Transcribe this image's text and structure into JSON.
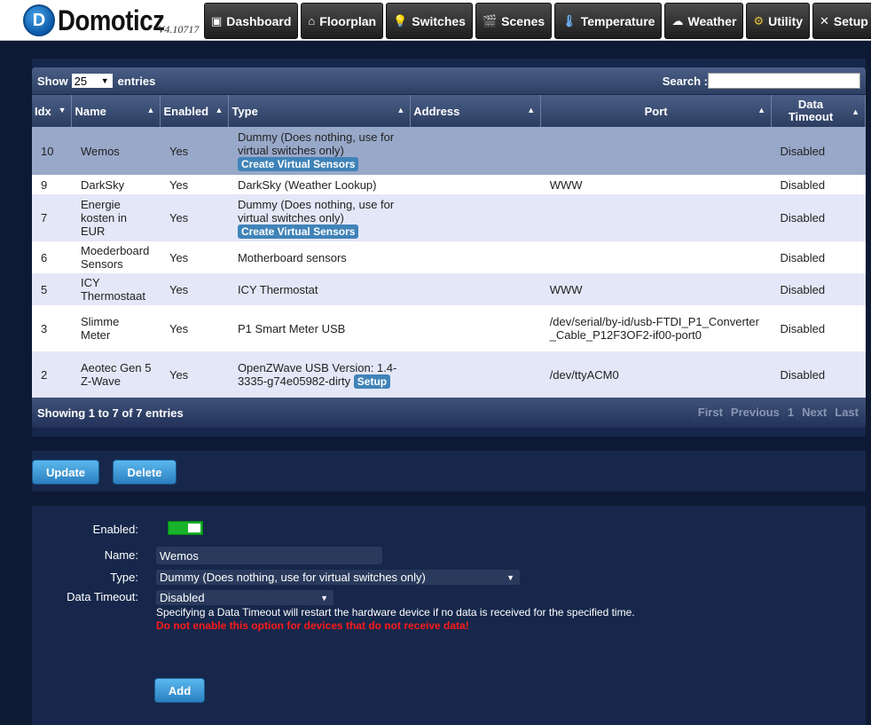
{
  "app": {
    "logo_letter": "D",
    "name": "Domoticz",
    "version": "V4.10717"
  },
  "nav": [
    {
      "label": "Dashboard",
      "icon": "dashboard-icon",
      "glyph": "▣"
    },
    {
      "label": "Floorplan",
      "icon": "floorplan-icon",
      "glyph": "⌂"
    },
    {
      "label": "Switches",
      "icon": "lightbulb-icon",
      "glyph": "💡"
    },
    {
      "label": "Scenes",
      "icon": "clapperboard-icon",
      "glyph": "🎬"
    },
    {
      "label": "Temperature",
      "icon": "thermometer-icon",
      "glyph": "🌡"
    },
    {
      "label": "Weather",
      "icon": "cloud-icon",
      "glyph": "☁"
    },
    {
      "label": "Utility",
      "icon": "utility-icon",
      "glyph": "⚙"
    },
    {
      "label": "Setup",
      "icon": "tools-icon",
      "glyph": "✕"
    }
  ],
  "table": {
    "show_label": "Show",
    "show_value": "25",
    "entries_label": "entries",
    "search_label": "Search :",
    "columns": [
      "Idx",
      "Name",
      "Enabled",
      "Type",
      "Address",
      "Port",
      "Data Timeout"
    ],
    "rows": [
      {
        "idx": "10",
        "name": "Wemos",
        "enabled": "Yes",
        "type": "Dummy (Does nothing, use for virtual switches only)",
        "button": "Create Virtual Sensors",
        "address": "",
        "port": "",
        "timeout": "Disabled"
      },
      {
        "idx": "9",
        "name": "DarkSky",
        "enabled": "Yes",
        "type": "DarkSky (Weather Lookup)",
        "button": "",
        "address": "",
        "port": "WWW",
        "timeout": "Disabled"
      },
      {
        "idx": "7",
        "name": "Energie kosten in EUR",
        "enabled": "Yes",
        "type": "Dummy (Does nothing, use for virtual switches only)",
        "button": "Create Virtual Sensors",
        "address": "",
        "port": "",
        "timeout": "Disabled"
      },
      {
        "idx": "6",
        "name": "Moederboard Sensors",
        "enabled": "Yes",
        "type": "Motherboard sensors",
        "button": "",
        "address": "",
        "port": "",
        "timeout": "Disabled"
      },
      {
        "idx": "5",
        "name": "ICY Thermostaat",
        "enabled": "Yes",
        "type": "ICY Thermostat",
        "button": "",
        "address": "",
        "port": "WWW",
        "timeout": "Disabled"
      },
      {
        "idx": "3",
        "name": "Slimme Meter",
        "enabled": "Yes",
        "type": "P1 Smart Meter USB",
        "button": "",
        "address": "",
        "port": "/dev/serial/by-id/usb-FTDI_P1_Converter_Cable_P12F3OF2-if00-port0",
        "timeout": "Disabled"
      },
      {
        "idx": "2",
        "name": "Aeotec Gen 5 Z-Wave",
        "enabled": "Yes",
        "type": "OpenZWave USB Version: 1.4-3335-g74e05982-dirty",
        "button": "Setup",
        "address": "",
        "port": "/dev/ttyACM0",
        "timeout": "Disabled"
      }
    ],
    "info": "Showing 1 to 7 of 7 entries",
    "pager": [
      "First",
      "Previous",
      "1",
      "Next",
      "Last"
    ]
  },
  "actions": {
    "update": "Update",
    "delete": "Delete"
  },
  "form": {
    "enabled_label": "Enabled:",
    "name_label": "Name:",
    "name_value": "Wemos",
    "type_label": "Type:",
    "type_value": "Dummy (Does nothing, use for virtual switches only)",
    "timeout_label": "Data Timeout:",
    "timeout_value": "Disabled",
    "hint": "Specifying a Data Timeout will restart the hardware device if no data is received for the specified time.",
    "warning": "Do not enable this option for devices that do not receive data!",
    "add": "Add"
  },
  "colors": {
    "background": "#0e1a33",
    "panel": "#16274b",
    "button_blue": "#2b7fbf",
    "toggle_on": "#18b32a",
    "warning_red": "#ff1a1a"
  }
}
